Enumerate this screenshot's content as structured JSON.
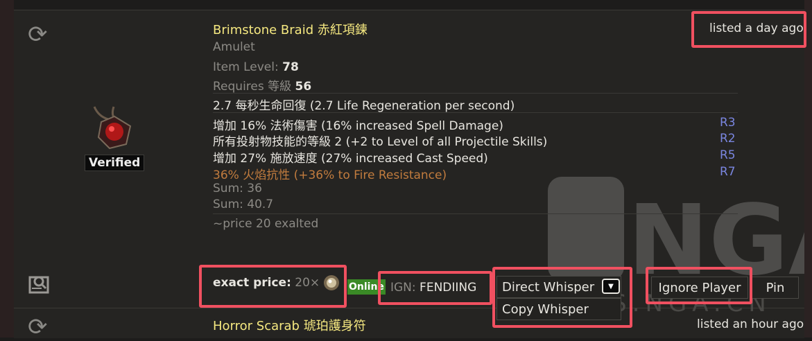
{
  "listing": {
    "item_name": "Brimstone Braid 赤紅項鍊",
    "item_type": "Amulet",
    "item_level_label": "Item Level:",
    "item_level_value": "78",
    "requires_label": "Requires 等級",
    "requires_value": "56",
    "implicit": "2.7 每秒生命回復 (2.7 Life Regeneration per second)",
    "mods": [
      {
        "text": "增加 16% 法術傷害 (16% increased Spell Damage)",
        "rank": "R3"
      },
      {
        "text": "所有投射物技能的等級 2 (+2 to Level of all Projectile Skills)",
        "rank": "R2"
      },
      {
        "text": "增加 27% 施放速度 (27% increased Cast Speed)",
        "rank": "R5"
      },
      {
        "text": "36% 火焰抗性 (+36% to Fire Resistance)",
        "rank": "R7"
      }
    ],
    "sum1": "Sum: 36",
    "sum2": "Sum: 40.7",
    "note": "~price 20 exalted",
    "listed": "listed a day ago",
    "verified": "Verified",
    "exact_price_label": "exact price:",
    "exact_price_value": "20×",
    "online": "Online",
    "ign_label": "IGN:",
    "ign_value": "FENDIING",
    "direct_whisper": "Direct Whisper",
    "copy_whisper": "Copy Whisper",
    "ignore_player": "Ignore Player",
    "pin": "Pin"
  },
  "next_listing": {
    "item_name": "Horror Scarab 琥珀護身符",
    "listed": "listed an hour ago"
  },
  "watermark": {
    "text": "NGA",
    "url_text": "BBS.NGA.CN"
  },
  "colors": {
    "item_name": "#f5e880",
    "highlight_box": "#f05060",
    "rank": "#7a86e0",
    "fire_mod": "#c27c3e",
    "online": "#3a8a26"
  },
  "icons": [
    "refresh-icon",
    "amulet-icon",
    "exalted-orb-icon",
    "search-listing-icon",
    "dropdown-caret-icon"
  ]
}
